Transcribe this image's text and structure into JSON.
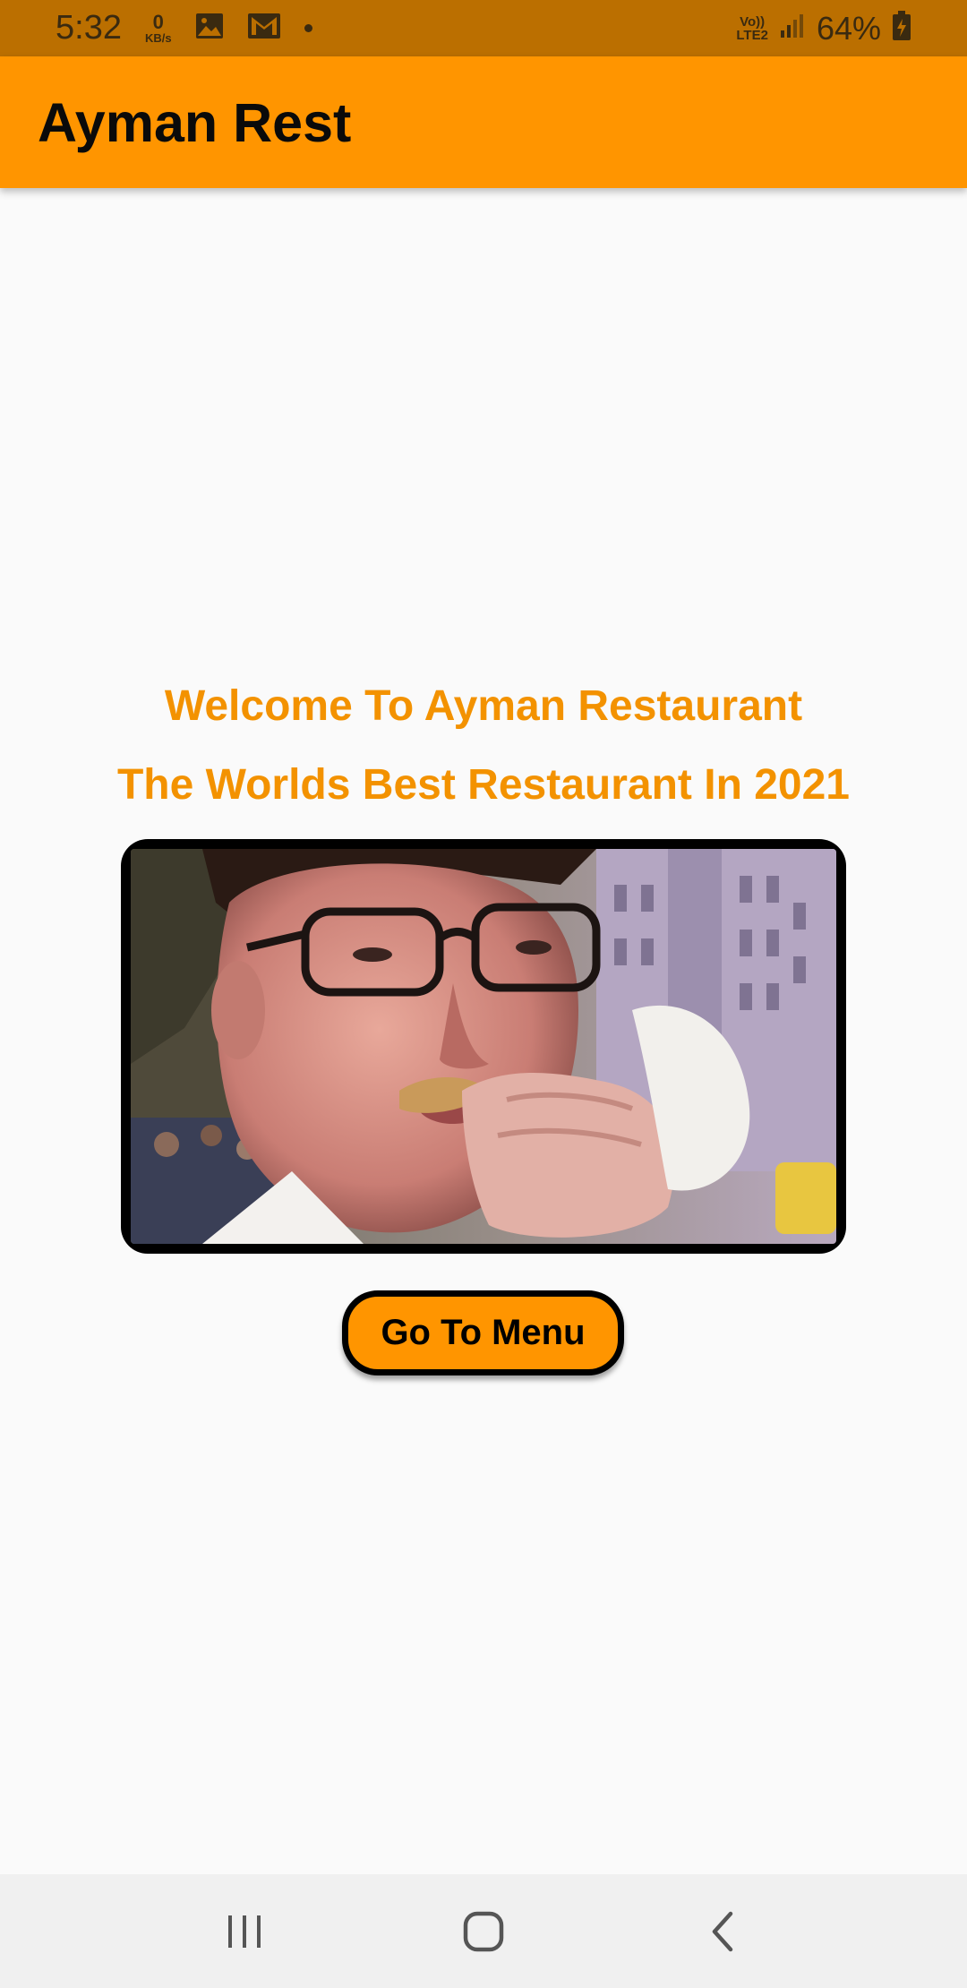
{
  "status_bar": {
    "time": "5:32",
    "net_speed_value": "0",
    "net_speed_unit": "KB/s",
    "volte_top": "Vo))",
    "volte_bottom": "LTE2",
    "battery_percent": "64%",
    "icons": [
      "gallery-icon",
      "gmail-icon",
      "notification-dot-icon",
      "signal-icon",
      "battery-charging-icon"
    ]
  },
  "app_bar": {
    "title": "Ayman Rest"
  },
  "main": {
    "welcome_line1": "Welcome To Ayman Restaurant",
    "welcome_line2": "The Worlds Best Restaurant In 2021",
    "menu_button_label": "Go To Menu"
  },
  "nav_bar": {
    "icons": [
      "recent-apps-icon",
      "home-icon",
      "back-icon"
    ]
  },
  "colors": {
    "status_bar": "#bb6f00",
    "app_bar": "#ff9500",
    "accent_text": "#f39200",
    "background": "#fafafa",
    "nav_bar": "#f0f0f0"
  }
}
